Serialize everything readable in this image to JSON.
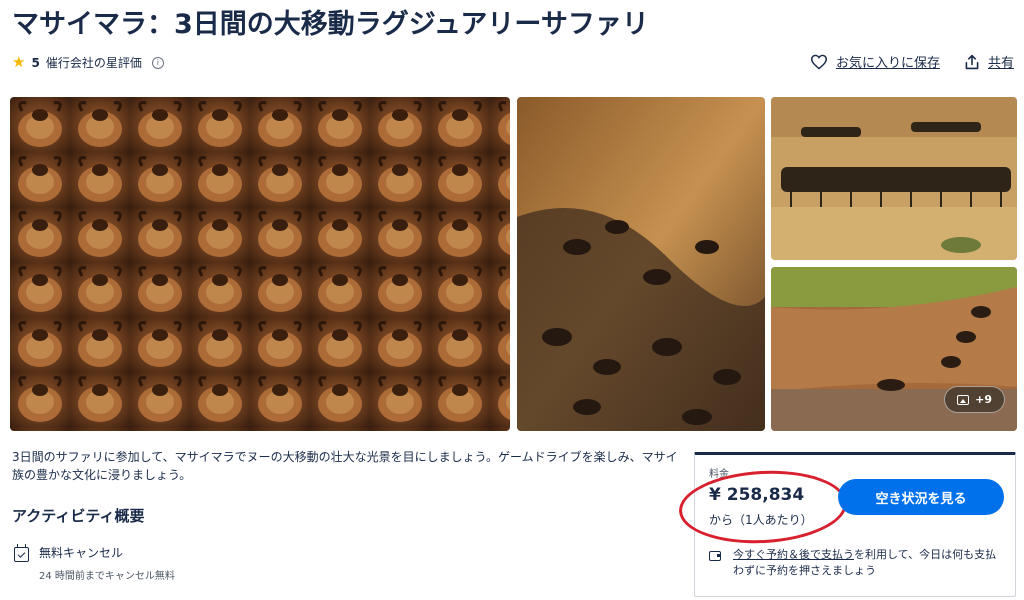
{
  "page": {
    "title": "マサイマラ：3日間の大移動ラグジュアリーサファリ",
    "rating_value": "5",
    "rating_label": "催行会社の星評価",
    "actions": {
      "wishlist_label": "お気に入りに保存",
      "share_label": "共有"
    }
  },
  "gallery": {
    "more_count": "+9"
  },
  "description": "3日間のサファリに参加して、マサイマラでヌーの大移動の壮大な光景を目にしましょう。ゲームドライブを楽しみ、マサイ族の豊かな文化に浸りましょう。",
  "overview": {
    "title": "アクティビティ概要",
    "feature_title": "無料キャンセル",
    "feature_sub": "24 時間前までキャンセル無料"
  },
  "price_card": {
    "label": "料金",
    "amount": "¥ 258,834",
    "per": "から（1人あたり）",
    "button_label": "空き状況を見る",
    "rnpl_link": "今すぐ予約＆後で支払う",
    "rnpl_rest": "を利用して、今日は何も支払わずに予約を押さえましょう"
  },
  "colors": {
    "brand_blue": "#0071eb",
    "text_dark": "#1a2b49",
    "annotation_red": "#d8202f",
    "star": "#f5b800"
  }
}
